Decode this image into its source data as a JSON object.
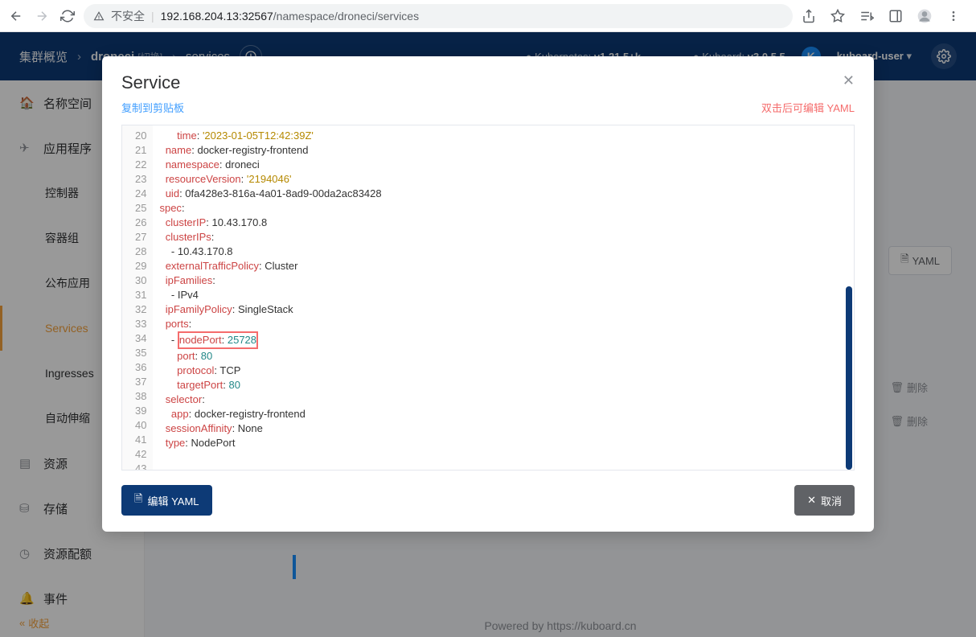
{
  "browser": {
    "security_text": "不安全",
    "url_host": "192.168.204.13:32567",
    "url_path": "/namespace/droneci/services"
  },
  "header": {
    "crumb1": "集群概览",
    "crumb2": "droneci",
    "crumb2_note": "[切换]",
    "crumb3": "services",
    "k8s_label": "Kubernetes:",
    "k8s_ver": "v1.21.5+k...",
    "kuboard_label": "Kuboard:",
    "kuboard_ver": "v3.0.5.5",
    "user": "kuboard-user"
  },
  "sidebar": {
    "items": [
      {
        "label": "名称空间"
      },
      {
        "label": "应用程序"
      },
      {
        "label": "控制器"
      },
      {
        "label": "容器组"
      },
      {
        "label": "公布应用"
      },
      {
        "label": "Services"
      },
      {
        "label": "Ingresses"
      },
      {
        "label": "自动伸缩"
      },
      {
        "label": "资源"
      },
      {
        "label": "存储"
      },
      {
        "label": "资源配额"
      },
      {
        "label": "事件"
      }
    ],
    "collapse": "收起"
  },
  "content": {
    "yaml_btn": "YAML",
    "delete_btn": "删除",
    "footer_pre": "Powered by ",
    "footer_link": "https://kuboard.cn"
  },
  "modal": {
    "title": "Service",
    "copy": "复制到剪贴板",
    "hint": "双击后可编辑 YAML",
    "edit_btn": "编辑 YAML",
    "cancel_btn": "取消",
    "yaml": {
      "l20": {
        "key": "time",
        "val": "'2023-01-05T12:42:39Z'"
      },
      "l21": {
        "key": "name",
        "val": "docker-registry-frontend"
      },
      "l22": {
        "key": "namespace",
        "val": "droneci"
      },
      "l23": {
        "key": "resourceVersion",
        "val": "'2194046'"
      },
      "l24": {
        "key": "uid",
        "val": "0fa428e3-816a-4a01-8ad9-00da2ac83428"
      },
      "l25": {
        "key": "spec"
      },
      "l26": {
        "key": "clusterIP",
        "val": "10.43.170.8"
      },
      "l27": {
        "key": "clusterIPs"
      },
      "l28": {
        "val": "- 10.43.170.8"
      },
      "l29": {
        "key": "externalTrafficPolicy",
        "val": "Cluster"
      },
      "l30": {
        "key": "ipFamilies"
      },
      "l31": {
        "val": "- IPv4"
      },
      "l32": {
        "key": "ipFamilyPolicy",
        "val": "SingleStack"
      },
      "l33": {
        "key": "ports"
      },
      "l34": {
        "key": "nodePort",
        "val": "25728"
      },
      "l35": {
        "key": "port",
        "val": "80"
      },
      "l36": {
        "key": "protocol",
        "val": "TCP"
      },
      "l37": {
        "key": "targetPort",
        "val": "80"
      },
      "l38": {
        "key": "selector"
      },
      "l39": {
        "key": "app",
        "val": "docker-registry-frontend"
      },
      "l40": {
        "key": "sessionAffinity",
        "val": "None"
      },
      "l41": {
        "key": "type",
        "val": "NodePort"
      }
    }
  }
}
